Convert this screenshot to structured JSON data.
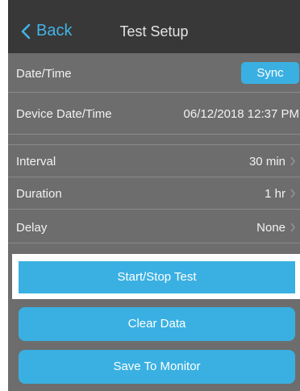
{
  "nav": {
    "back_label": "Back",
    "title": "Test Setup"
  },
  "rows": {
    "date_time": {
      "label": "Date/Time",
      "button": "Sync"
    },
    "device_date_time": {
      "label": "Device Date/Time",
      "value": "06/12/2018 12:37 PM"
    },
    "interval": {
      "label": "Interval",
      "value": "30 min"
    },
    "duration": {
      "label": "Duration",
      "value": "1 hr"
    },
    "delay": {
      "label": "Delay",
      "value": "None"
    }
  },
  "actions": {
    "start_stop": "Start/Stop Test",
    "clear_data": "Clear Data",
    "save_to_monitor": "Save To Monitor"
  },
  "colors": {
    "accent": "#3ab0e2",
    "navbar": "#383838",
    "background": "#6d6d6d",
    "highlight": "#ffffff"
  },
  "icons": {
    "back": "chevron-left-icon",
    "row_arrow": "chevron-right-icon"
  }
}
